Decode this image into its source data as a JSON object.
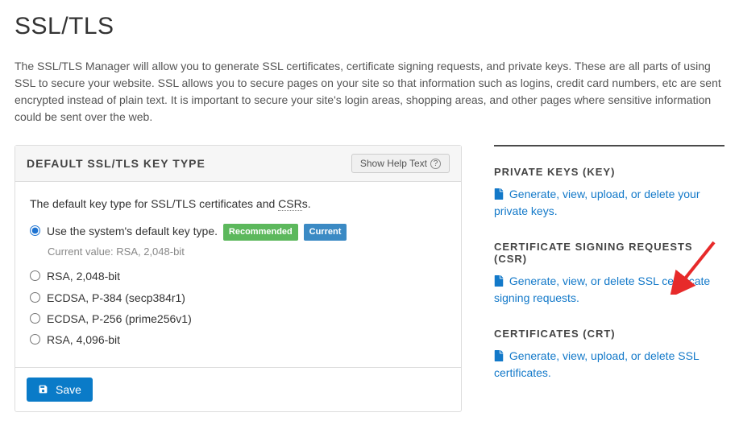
{
  "page_title": "SSL/TLS",
  "intro_text": "The SSL/TLS Manager will allow you to generate SSL certificates, certificate signing requests, and private keys. These are all parts of using SSL to secure your website. SSL allows you to secure pages on your site so that information such as logins, credit card numbers, etc are sent encrypted instead of plain text. It is important to secure your site's login areas, shopping areas, and other pages where sensitive information could be sent over the web.",
  "panel": {
    "title": "DEFAULT SSL/TLS KEY TYPE",
    "help_button": "Show Help Text",
    "intro_before": "The default key type for SSL/TLS certificates and ",
    "intro_abbr": "CSR",
    "intro_after": "s.",
    "badge_recommended": "Recommended",
    "badge_current": "Current",
    "current_value_label": "Current value: RSA, 2,048-bit",
    "options": [
      {
        "label": "Use the system's default key type.",
        "checked": true,
        "recommended": true,
        "current": true
      },
      {
        "label": "RSA, 2,048-bit",
        "checked": false
      },
      {
        "label": "ECDSA, P-384 (secp384r1)",
        "checked": false
      },
      {
        "label": "ECDSA, P-256 (prime256v1)",
        "checked": false
      },
      {
        "label": "RSA, 4,096-bit",
        "checked": false
      }
    ],
    "save_label": "Save"
  },
  "sidebar": {
    "private_keys": {
      "heading": "PRIVATE KEYS (KEY)",
      "link": "Generate, view, upload, or delete your private keys."
    },
    "csr": {
      "heading": "CERTIFICATE SIGNING REQUESTS (CSR)",
      "link": "Generate, view, or delete SSL certificate signing requests."
    },
    "crt": {
      "heading": "CERTIFICATES (CRT)",
      "link": "Generate, view, upload, or delete SSL certificates."
    }
  }
}
